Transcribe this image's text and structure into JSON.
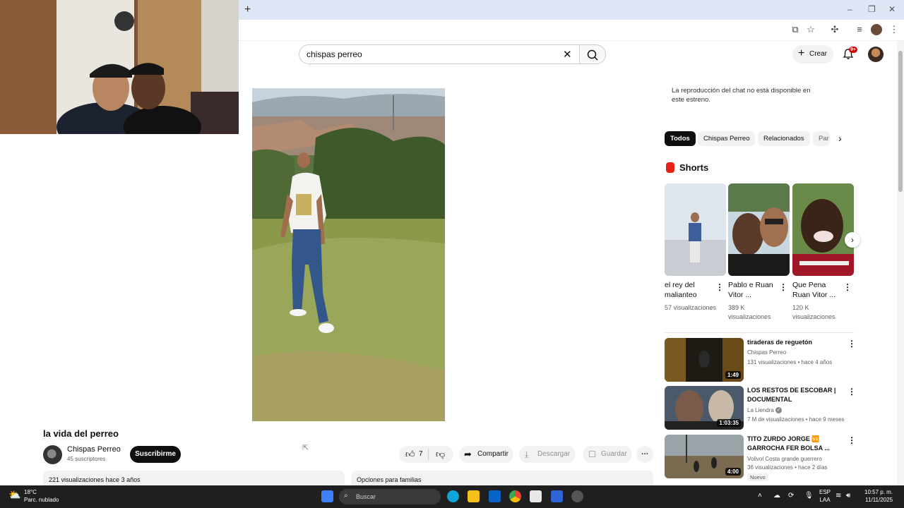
{
  "browser": {
    "newtab_symbol": "+"
  },
  "search": {
    "query": "chispas perreo"
  },
  "masthead": {
    "create_label": "Crear",
    "notification_count": "9+"
  },
  "video": {
    "title": "la vida del perreo",
    "channel": "Chispas Perreo",
    "subscribers": "45 suscriptores",
    "subscribe_label": "Suscribirme",
    "likes": "7",
    "share_label": "Compartir",
    "download_label": "Descargar",
    "save_label": "Guardar",
    "views_date": "221 visualizaciones  hace 3 años",
    "family_options": "Opciones para familias"
  },
  "chat": {
    "message": "La reproducción del chat no está disponible en este estreno."
  },
  "chips": [
    "Todos",
    "Chispas Perreo",
    "Relacionados",
    "Par"
  ],
  "shorts": {
    "heading": "Shorts",
    "items": [
      {
        "title": "el rey del malianteo",
        "views": "57 visualizaciones"
      },
      {
        "title": "Pablo e Ruan Vitor ...",
        "views": "389 K visualizaciones"
      },
      {
        "title": "Que Pena Ruan Vitor ...",
        "views": "120 K visualizaciones"
      }
    ]
  },
  "recommended": [
    {
      "title": "tiraderas de reguetón",
      "channel": "Chispas Perreo",
      "meta": "131 visualizaciones • hace 4 años",
      "duration": "1:49"
    },
    {
      "title": "LOS RESTOS DE ESCOBAR | DOCUMENTAL",
      "channel": "La Liendra",
      "meta": "7 M de visualizaciones • hace 9 meses",
      "duration": "1:03:35"
    },
    {
      "title": "TITO ZURDO JORGE 🆚 GARROCHA FER BOLSA ...",
      "channel": "Volivol Costa grande guerrero",
      "meta": "36 visualizaciones • hace 2 días",
      "duration": "4:00",
      "badge": "Nuevo"
    }
  ],
  "taskbar": {
    "temperature": "18°C",
    "weather": "Parc. nublado",
    "search_placeholder": "Buscar",
    "lang1": "ESP",
    "lang2": "LAA",
    "time": "10:57 p. m.",
    "date": "11/11/2025"
  }
}
